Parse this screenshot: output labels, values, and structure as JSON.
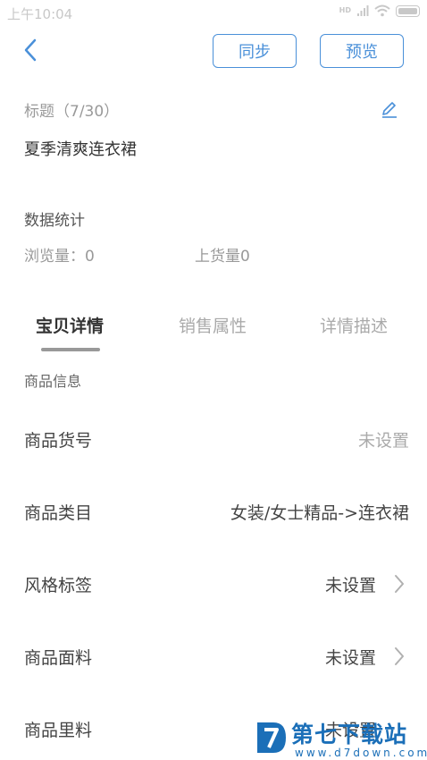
{
  "status_bar": {
    "time": "上午10:04",
    "network_label": "HD"
  },
  "header": {
    "sync_label": "同步",
    "preview_label": "预览"
  },
  "title_section": {
    "label": "标题（7/30）",
    "value": "夏季清爽连衣裙"
  },
  "stats": {
    "heading": "数据统计",
    "views": "浏览量：0",
    "shelf": "上货量0"
  },
  "tabs": [
    {
      "label": "宝贝详情",
      "active": true
    },
    {
      "label": "销售属性",
      "active": false
    },
    {
      "label": "详情描述",
      "active": false
    }
  ],
  "section_label": "商品信息",
  "rows": [
    {
      "label": "商品货号",
      "value": "未设置"
    },
    {
      "label": "商品类目",
      "value": "女装/女士精品->连衣裙"
    },
    {
      "label": "风格标签",
      "value": "未设置"
    },
    {
      "label": "商品面料",
      "value": "未设置"
    },
    {
      "label": "商品里料",
      "value": "未设置"
    }
  ],
  "watermark": {
    "text": "第七下载站",
    "url": "www.d7down.com"
  },
  "colors": {
    "accent": "#4a90d9",
    "muted": "#aaaaaa",
    "text": "#444444",
    "watermark": "#1b6fb8"
  }
}
